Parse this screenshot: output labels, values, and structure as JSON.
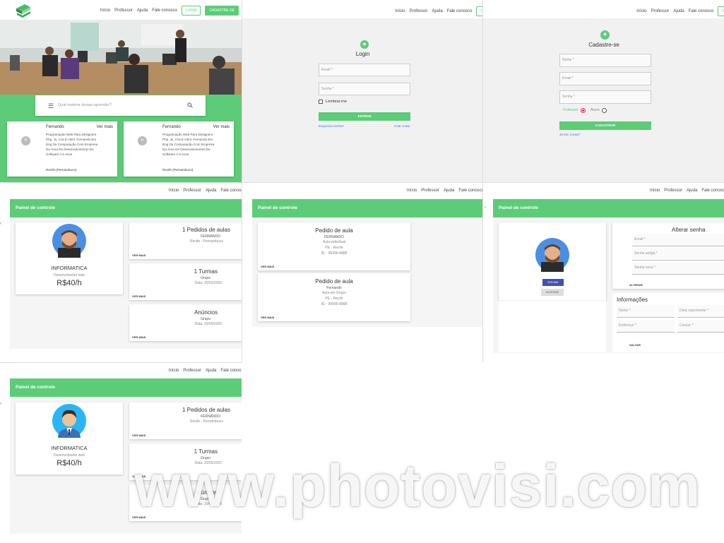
{
  "nav": {
    "inicio": "Início",
    "professor": "Professor",
    "ajuda": "Ajuda",
    "fale": "Fale conosco",
    "login": "LOGIN",
    "cadastre": "CADASTRE-SE",
    "cad_short": "C"
  },
  "home": {
    "search_placeholder": "Qual matéria deseja aprender?",
    "cards": [
      {
        "initial": "R",
        "name": "Fernando",
        "more": "Ver mais",
        "desc": "Programação Web Para Designers - Php, Js, Css E Html. Fernando Em Eng Da Computação Com Empresa Na Área De Desenvolvimento De Software A 5 Anos",
        "loc": "Recife (Pernambuco)"
      },
      {
        "initial": "R",
        "name": "Fernando",
        "more": "Ver mais",
        "desc": "Programação Web Para Designers - Php, Js, Css E Html. Fernando Em Eng Da Computação Com Empresa Na Área De Desenvolvimento De Software A 5 Anos",
        "loc": "Recife (Pernambuco)"
      }
    ]
  },
  "login": {
    "title": "Login",
    "email": "Email *",
    "senha": "Senha *",
    "lembrar": "Lembrar-me",
    "entrar": "ENTRAR",
    "esqueceu": "Esqueceu senha?",
    "criar": "Criar conta"
  },
  "signup": {
    "title": "Cadastre-se",
    "nome": "Nome *",
    "email": "Email *",
    "senha": "Senha *",
    "professor": "Professor",
    "aluno": "Aluno",
    "btn": "CADASTRAR",
    "ja": "Já tem Conta?"
  },
  "dash1": {
    "title": "Painel de controle",
    "profile": {
      "subject": "INFORMATICA",
      "role": "Desenvolvedor web",
      "price": "R$40/h"
    },
    "cards": [
      {
        "title": "1 Pedidos de aulas",
        "l1": "FERNANDO",
        "l2": "Recife - Pernambuco",
        "more": "VER MAIS"
      },
      {
        "title": "1 Turmas",
        "l1": "Grupo",
        "l2": "Data: 20/05/2020",
        "more": "VER MAIS"
      },
      {
        "title": "Anúncios",
        "l1": "Grupo",
        "l2": "Data: 20/05/2020",
        "more": "VER MAIS"
      }
    ]
  },
  "dash2": {
    "title": "Painel de controle",
    "requests": [
      {
        "title": "Pedido de aula",
        "l1": "FERNANDO",
        "l2": "Aula individual",
        "l3": "PE - Recife",
        "l4": "81 - 99999-8888",
        "more": "VER MAIS"
      },
      {
        "title": "Pedido de aula",
        "l1": "Fernando",
        "l2": "Aula em Grupo",
        "l3": "PE - Recife",
        "l4": "81 - 99999-8888",
        "more": "VER MAIS"
      }
    ]
  },
  "dash3": {
    "title": "Painel de controle",
    "enviar": "ENVIAR",
    "alterar": "ALTERAR",
    "senha": {
      "title": "Alterar senha",
      "email": "Email *",
      "antiga": "Senha antiga *",
      "nova": "Senha nova *",
      "btn": "ALTERAR"
    },
    "info": {
      "title": "Informações",
      "nome": "Nome *",
      "data": "Data nascimento *",
      "endereco": "Endereço *",
      "celular": "Celular *",
      "btn": "SALVAR"
    }
  },
  "dash4": {
    "title": "Painel de controle",
    "profile": {
      "subject": "INFORMATICA",
      "role": "Desenvolvedor web",
      "price": "R$40/h"
    },
    "cards": [
      {
        "title": "1 Pedidos de aulas",
        "l1": "FERNANDO",
        "l2": "Recife - Pernambuco",
        "more": "VER MAIS"
      },
      {
        "title": "1 Turmas",
        "l1": "Grupo",
        "l2": "Data: 20/05/2020",
        "more": "VER MAIS"
      },
      {
        "title": "Anúncios",
        "l1": "Grupo",
        "l2": "Data: 20/05/2020",
        "more": "VER MAIS"
      }
    ]
  },
  "watermark": "www.photovisi.com"
}
